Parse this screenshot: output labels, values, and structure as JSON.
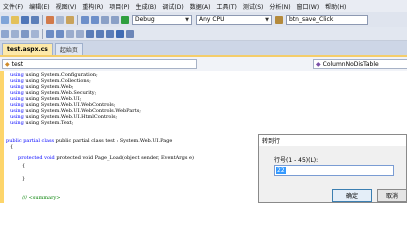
{
  "menu": [
    "文件(F)",
    "编辑(E)",
    "视图(V)",
    "重构(R)",
    "项目(P)",
    "生成(B)",
    "调试(D)",
    "数据(A)",
    "工具(T)",
    "测试(S)",
    "分析(N)",
    "窗口(W)",
    "帮助(H)"
  ],
  "toolbar": {
    "config": "Debug",
    "platform": "Any CPU",
    "find_value": "btn_save_Click"
  },
  "tabs": [
    {
      "label": "test.aspx.cs",
      "active": true
    },
    {
      "label": "起始页",
      "active": false
    }
  ],
  "nav": {
    "class_combo": "test",
    "member_combo": "ColumnNoDisTable"
  },
  "code": [
    "using System.Configuration;",
    "using System.Collections;",
    "using System.Web;",
    "using System.Web.Security;",
    "using System.Web.UI;",
    "using System.Web.UI.WebControls;",
    "using System.Web.UI.WebControls.WebParts;",
    "using System.Web.UI.HtmlControls;",
    "using System.Text;",
    "public partial class test : System.Web.UI.Page",
    "{",
    "protected void Page_Load(object sender, EventArgs e)",
    "{",
    "}",
    "/// <summary>"
  ],
  "dialog": {
    "title": "转到行",
    "label": "行号(1 - 45)(L):",
    "value": "22",
    "ok": "确定",
    "cancel": "取消"
  }
}
